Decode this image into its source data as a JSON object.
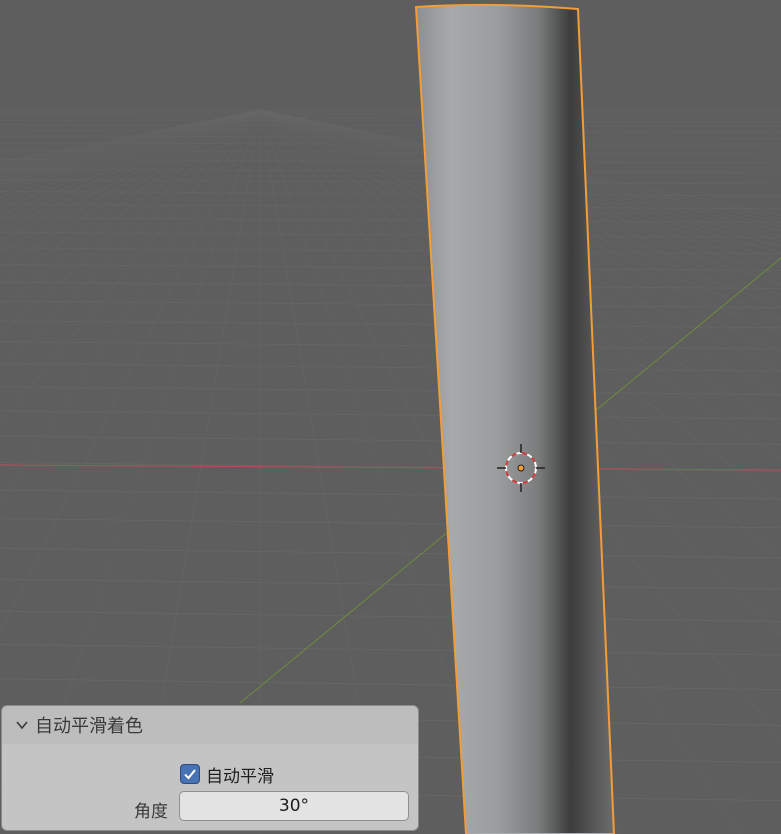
{
  "viewport": {
    "background_color": "#5e5e5e",
    "grid_color": "#686868",
    "x_axis_color": "#b5505a",
    "y_axis_color": "#6c8c3e",
    "selection_outline_color": "#f29d37",
    "object": "cylinder-selected",
    "origin_icon": "3d-cursor-icon"
  },
  "operator_panel": {
    "title": "自动平滑着色",
    "expanded": true,
    "chevron_icon": "chevron-down-icon",
    "auto_smooth": {
      "label": "自动平滑",
      "checked": true,
      "check_icon": "checkmark-icon",
      "accent_color": "#4772b3"
    },
    "angle": {
      "label": "角度",
      "value": "30°"
    }
  }
}
